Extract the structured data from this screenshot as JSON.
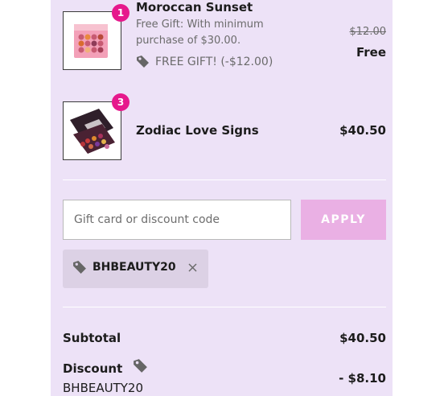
{
  "items": [
    {
      "badge": "1",
      "name": "Moroccan Sunset",
      "note": "Free Gift: With minimum purchase of $30.00.",
      "tag_text": "FREE GIFT! (-$12.00)",
      "original_price": "$12.00",
      "price": "Free"
    },
    {
      "badge": "3",
      "name": "Zodiac Love Signs",
      "price": "$40.50"
    }
  ],
  "discount": {
    "placeholder": "Gift card or discount code",
    "apply_label": "APPLY",
    "applied_code": "BHBEAUTY20"
  },
  "summary": {
    "subtotal_label": "Subtotal",
    "subtotal_value": "$40.50",
    "discount_label": "Discount",
    "discount_code": "BHBEAUTY20",
    "discount_value": "- $8.10"
  },
  "colors": {
    "panel_bg": "#ede2f7",
    "badge": "#e6198c",
    "apply_button": "#eab0e4",
    "chip_bg": "#dcd1e5"
  }
}
